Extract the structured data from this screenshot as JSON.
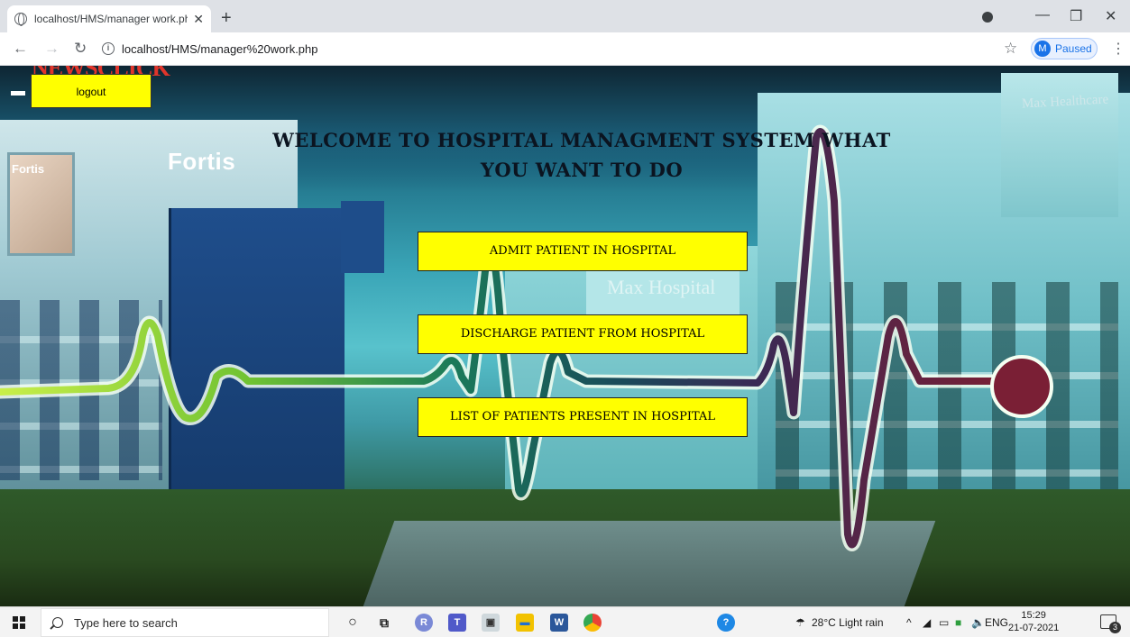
{
  "browser": {
    "tab_title": "localhost/HMS/manager work.ph",
    "url": "localhost/HMS/manager%20work.php",
    "profile_initial": "M",
    "profile_status": "Paused"
  },
  "background": {
    "brand_fortis": "Fortis",
    "brand_fortis_small": "Fortis",
    "brand_max_hospital": "Max Hospital",
    "brand_max_healthcare": "Max Healthcare",
    "watermark": "NEWSCLICK"
  },
  "page": {
    "logout_label": "logout",
    "welcome_text": "WELCOME TO HOSPITAL MANAGMENT SYSTEM WHAT YOU WANT TO DO",
    "buttons": {
      "admit": "ADMIT PATIENT IN HOSPITAL",
      "discharge": "DISCHARGE PATIENT FROM HOSPITAL",
      "list": "LIST OF PATIENTS PRESENT IN HOSPITAL"
    }
  },
  "taskbar": {
    "search_placeholder": "Type here to search",
    "weather": "28°C  Light rain",
    "language": "ENG",
    "time": "15:29",
    "date": "21-07-2021",
    "notifications": "3"
  },
  "colors": {
    "button_bg": "#ffff00",
    "ecg_green": "#8cd236",
    "ecg_maroon": "#7a1f35"
  }
}
